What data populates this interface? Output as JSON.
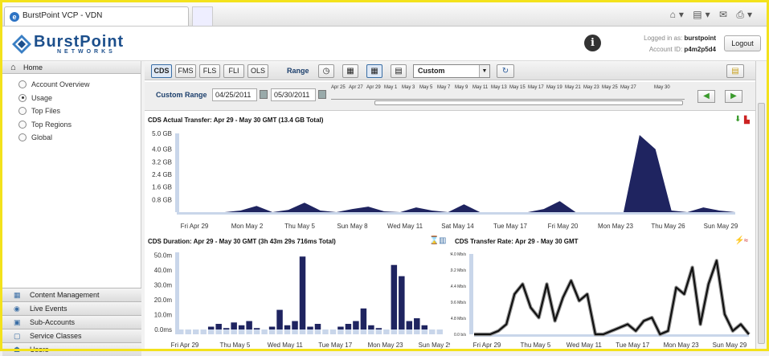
{
  "browser": {
    "tab_title": "BurstPoint VCP - VDN"
  },
  "header": {
    "brand": "BurstPoint",
    "brand_sub": "NETWORKS",
    "logged_in_label": "Logged in as:",
    "logged_in_user": "burstpoint",
    "account_label": "Account ID:",
    "account_id": "p4m2p5d4",
    "logout_label": "Logout"
  },
  "sidebar": {
    "home_label": "Home",
    "items": [
      {
        "label": "Account Overview",
        "selected": false
      },
      {
        "label": "Usage",
        "selected": true
      },
      {
        "label": "Top Files",
        "selected": false
      },
      {
        "label": "Top Regions",
        "selected": false
      },
      {
        "label": "Global",
        "selected": false
      }
    ],
    "sections": [
      {
        "label": "Content Management"
      },
      {
        "label": "Live Events"
      },
      {
        "label": "Sub-Accounts"
      },
      {
        "label": "Service Classes"
      },
      {
        "label": "Users"
      }
    ]
  },
  "toolbar": {
    "types": [
      "CDS",
      "FMS",
      "FLS",
      "FLI",
      "OLS"
    ],
    "active_type": "CDS",
    "range_label": "Range",
    "range_value": "Custom"
  },
  "range_bar": {
    "custom_range_label": "Custom Range",
    "start_date": "04/25/2011",
    "end_date": "05/30/2011",
    "timeline_labels": [
      "Apr 25",
      "Apr 27",
      "Apr 29",
      "May 1",
      "May 3",
      "May 5",
      "May 7",
      "May 9",
      "May 11",
      "May 13",
      "May 15",
      "May 17",
      "May 19",
      "May 21",
      "May 23",
      "May 25",
      "May 27",
      "May 30"
    ]
  },
  "chart_data": [
    {
      "type": "area",
      "title": "CDS Actual Transfer: Apr 29 - May 30 GMT (13.4 GB Total)",
      "x_labels": [
        "Fri Apr 29",
        "Mon May 2",
        "Thu May 5",
        "Sun May 8",
        "Wed May 11",
        "Sat May 14",
        "Tue May 17",
        "Fri May 20",
        "Mon May 23",
        "Thu May 26",
        "Sun May 29"
      ],
      "yticks": [
        "0.8 GB",
        "1.6 GB",
        "2.4 GB",
        "3.2 GB",
        "4.0 GB",
        "5.0 GB"
      ],
      "ylim": [
        0,
        5.0
      ],
      "values": [
        0,
        0,
        0,
        0,
        0.1,
        0.4,
        0,
        0.15,
        0.6,
        0.1,
        0,
        0.2,
        0.35,
        0.05,
        0,
        0.3,
        0.1,
        0,
        0.5,
        0,
        0,
        0,
        0,
        0.2,
        0.7,
        0,
        0,
        0,
        0,
        4.9,
        4.0,
        0.1,
        0,
        0.3,
        0.1,
        0
      ]
    },
    {
      "type": "bar",
      "title": "CDS Duration: Apr 29 - May 30 GMT (3h 43m 29s 716ms Total)",
      "x_labels": [
        "Fri Apr 29",
        "Thu May 5",
        "Wed May 11",
        "Tue May 17",
        "Mon May 23",
        "Sun May 29"
      ],
      "yticks": [
        "0.0ms",
        "10.0m",
        "20.0m",
        "30.0m",
        "40.0m",
        "50.0m"
      ],
      "ylim": [
        0,
        55
      ],
      "values": [
        0,
        0,
        0,
        0,
        2,
        4,
        1,
        5,
        3,
        6,
        1,
        0,
        2,
        14,
        3,
        6,
        52,
        2,
        4,
        0,
        0,
        2,
        4,
        6,
        15,
        3,
        1,
        0,
        46,
        38,
        6,
        8,
        3,
        0,
        0
      ]
    },
    {
      "type": "line",
      "title": "CDS Transfer Rate: Apr 29 - May 30 GMT",
      "x_labels": [
        "Fri Apr 29",
        "Thu May 5",
        "Wed May 11",
        "Tue May 17",
        "Mon May 23",
        "Sun May 29"
      ],
      "yticks": [
        "0.0 b/s",
        "4.8 Mb/s",
        "9.6 Mb/s",
        "14.4 Mb/s",
        "19.2 Mb/s",
        "24.0 Mb/s"
      ],
      "ylim": [
        0,
        24
      ],
      "values": [
        0,
        0,
        0,
        1,
        3,
        12,
        15,
        8,
        5,
        15,
        4,
        11,
        16,
        10,
        12,
        0,
        0,
        1,
        2,
        3,
        1,
        4,
        5,
        0,
        1,
        14,
        12,
        20,
        3,
        15,
        22,
        6,
        1,
        3,
        0
      ]
    }
  ]
}
